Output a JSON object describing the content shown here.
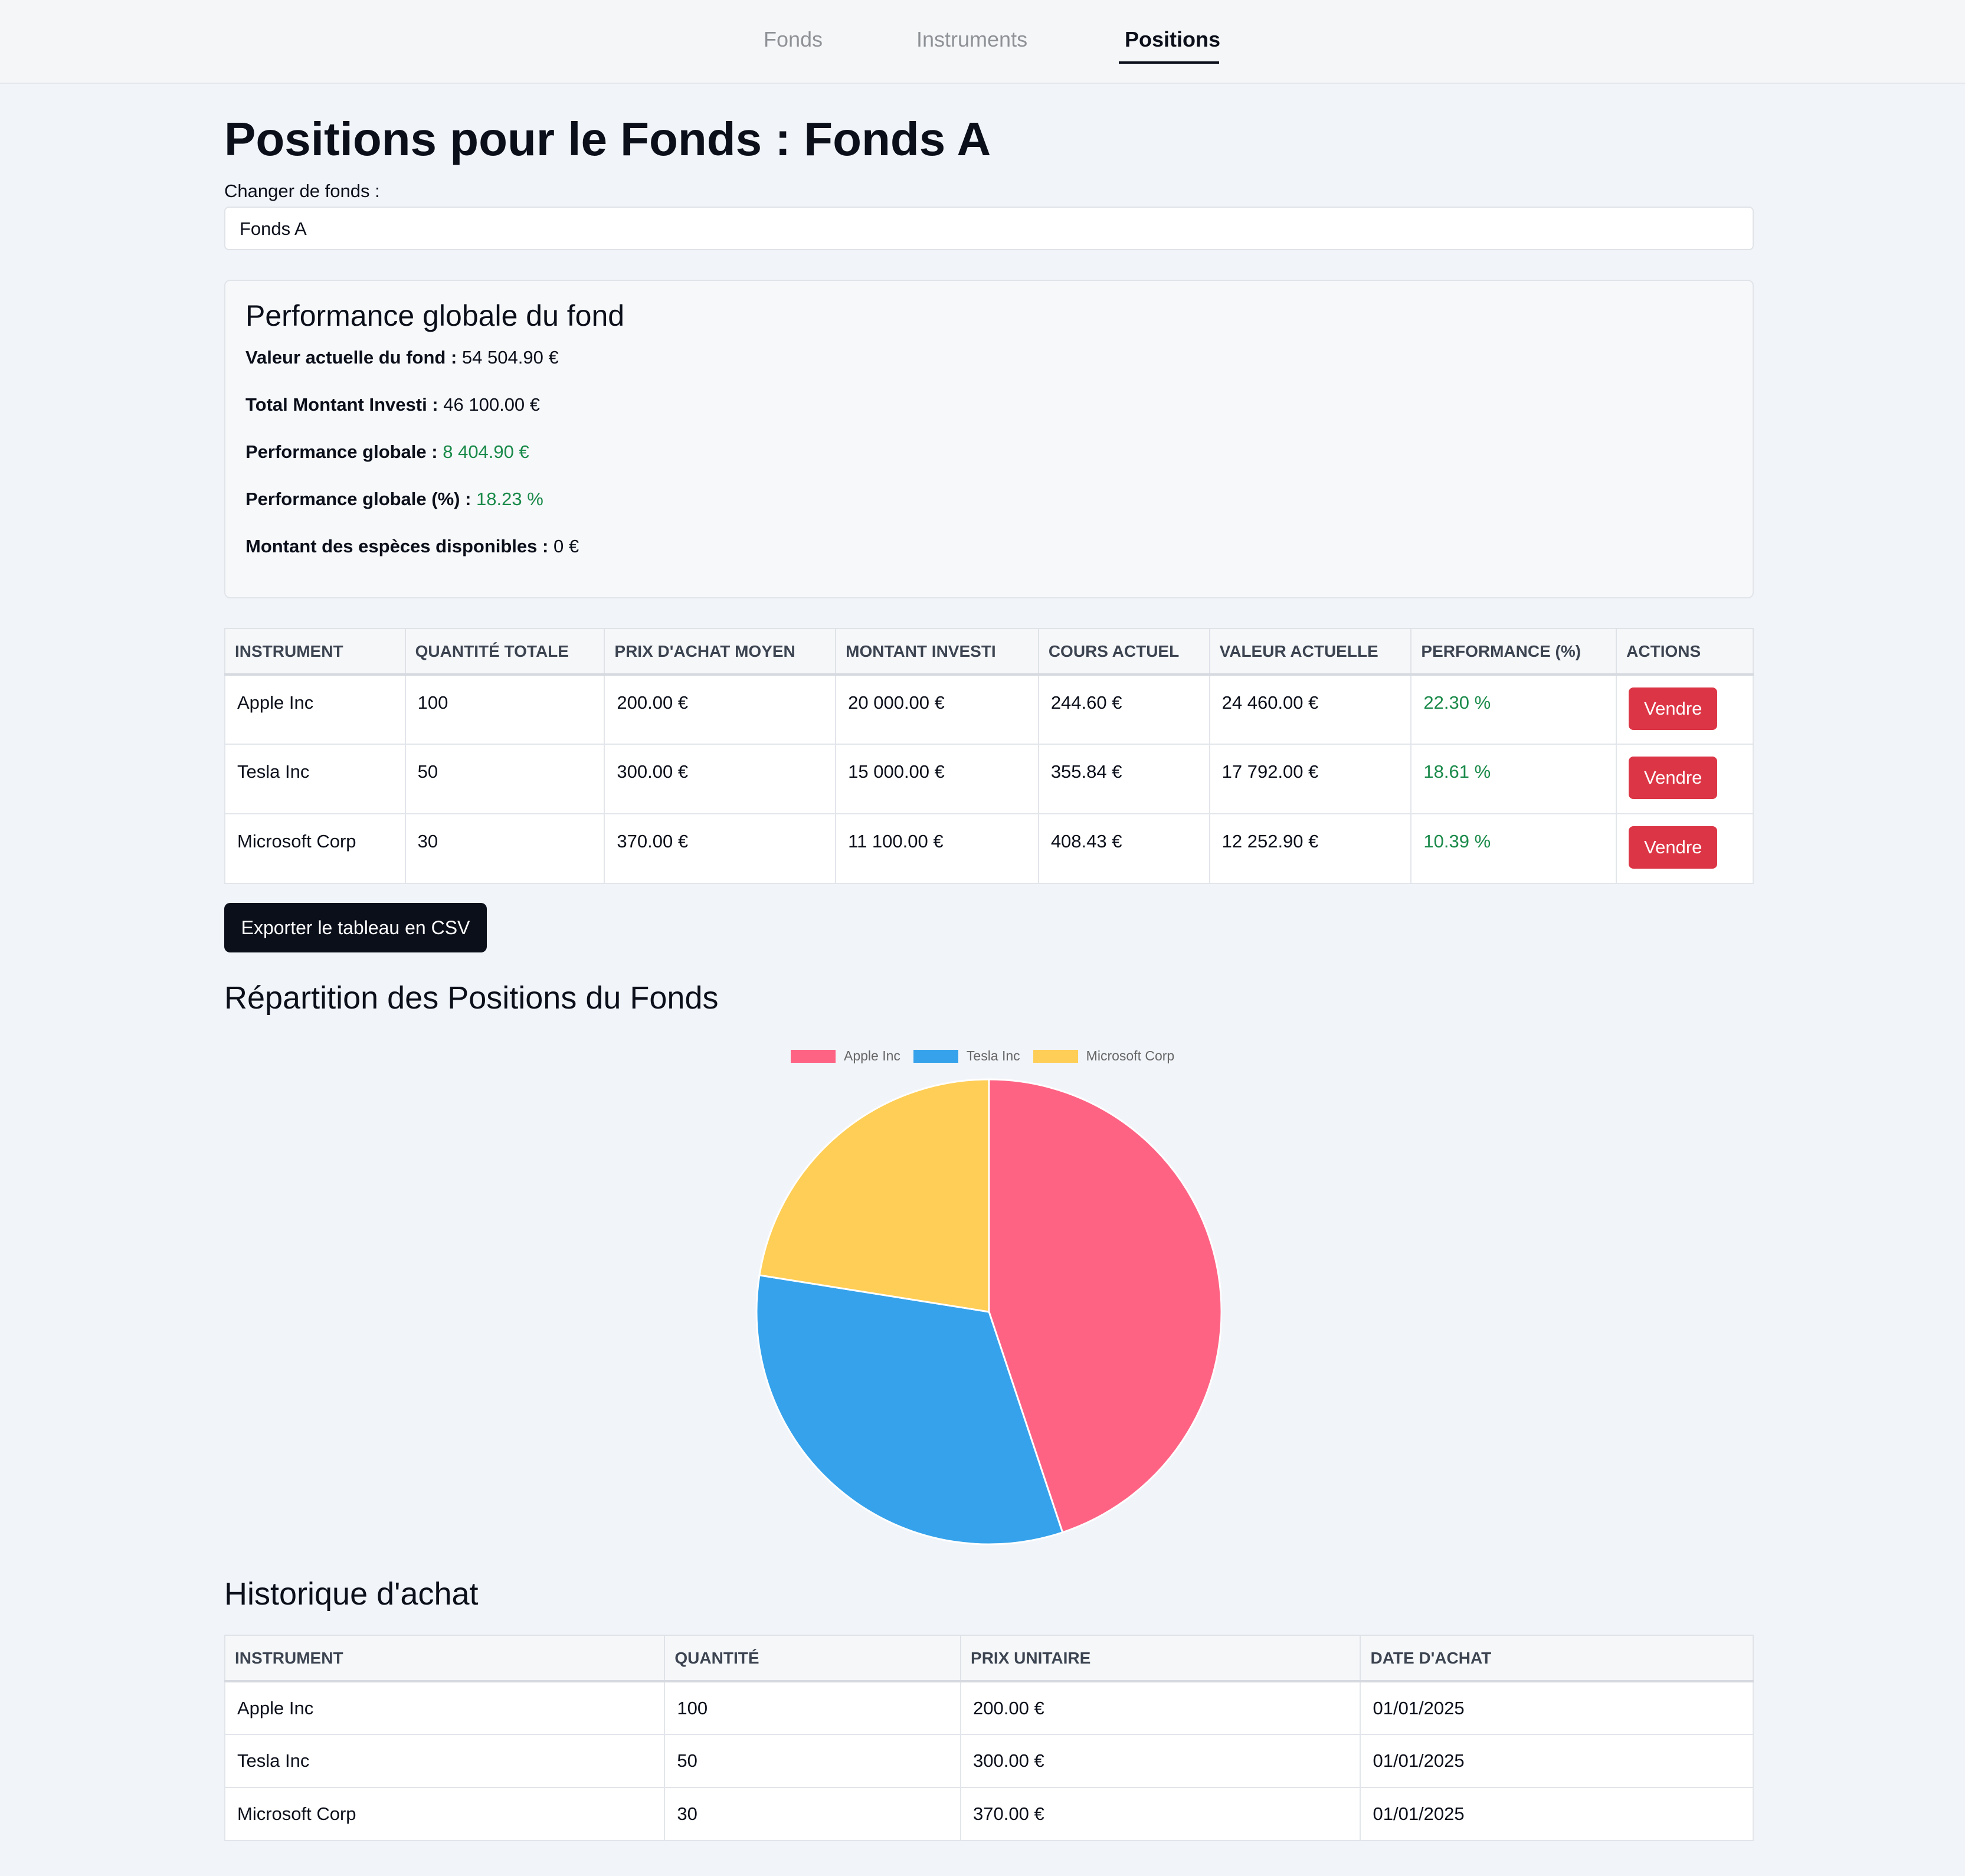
{
  "nav": {
    "tabs": [
      {
        "label": "Fonds"
      },
      {
        "label": "Instruments"
      },
      {
        "label": "Positions"
      }
    ]
  },
  "page": {
    "title": "Positions pour le Fonds : Fonds A",
    "fund_label": "Changer de fonds :",
    "fund_selected": "Fonds A"
  },
  "performance": {
    "title": "Performance globale du fond",
    "lines": [
      {
        "label": "Valeur actuelle du fond :",
        "value": "54 504.90 €"
      },
      {
        "label": "Total Montant Investi :",
        "value": "46 100.00 €"
      },
      {
        "label": "Performance globale :",
        "value": "8 404.90 €"
      },
      {
        "label": "Performance globale (%) :",
        "value": "18.23 %"
      },
      {
        "label": "Montant des espèces disponibles :",
        "value": "0 €"
      }
    ]
  },
  "positions": {
    "headers": [
      "INSTRUMENT",
      "QUANTITÉ TOTALE",
      "PRIX D'ACHAT MOYEN",
      "MONTANT INVESTI",
      "COURS ACTUEL",
      "VALEUR ACTUELLE",
      "PERFORMANCE (%)",
      "ACTIONS"
    ],
    "rows": [
      {
        "instrument": "Apple Inc",
        "qty": "100",
        "avg_price": "200.00 €",
        "invested": "20 000.00 €",
        "price": "244.60 €",
        "value": "24 460.00 €",
        "perf": "22.30 %",
        "action": "Vendre"
      },
      {
        "instrument": "Tesla Inc",
        "qty": "50",
        "avg_price": "300.00 €",
        "invested": "15 000.00 €",
        "price": "355.84 €",
        "value": "17 792.00 €",
        "perf": "18.61 %",
        "action": "Vendre"
      },
      {
        "instrument": "Microsoft Corp",
        "qty": "30",
        "avg_price": "370.00 €",
        "invested": "11 100.00 €",
        "price": "408.43 €",
        "value": "12 252.90 €",
        "perf": "10.39 %",
        "action": "Vendre"
      }
    ]
  },
  "export_label": "Exporter le tableau en CSV",
  "distribution": {
    "title": "Répartition des Positions du Fonds"
  },
  "chart_data": {
    "type": "pie",
    "categories": [
      "Apple Inc",
      "Tesla Inc",
      "Microsoft Corp"
    ],
    "values": [
      24460.0,
      17792.0,
      12252.9
    ],
    "colors": [
      "#ff6384",
      "#36a2eb",
      "#ffce56"
    ],
    "legend": "top"
  },
  "history": {
    "title": "Historique d'achat",
    "headers": [
      "INSTRUMENT",
      "QUANTITÉ",
      "PRIX UNITAIRE",
      "DATE D'ACHAT"
    ],
    "rows": [
      {
        "instrument": "Apple Inc",
        "qty": "100",
        "unit_price": "200.00 €",
        "date": "01/01/2025"
      },
      {
        "instrument": "Tesla Inc",
        "qty": "50",
        "unit_price": "300.00 €",
        "date": "01/01/2025"
      },
      {
        "instrument": "Microsoft Corp",
        "qty": "30",
        "unit_price": "370.00 €",
        "date": "01/01/2025"
      }
    ]
  }
}
